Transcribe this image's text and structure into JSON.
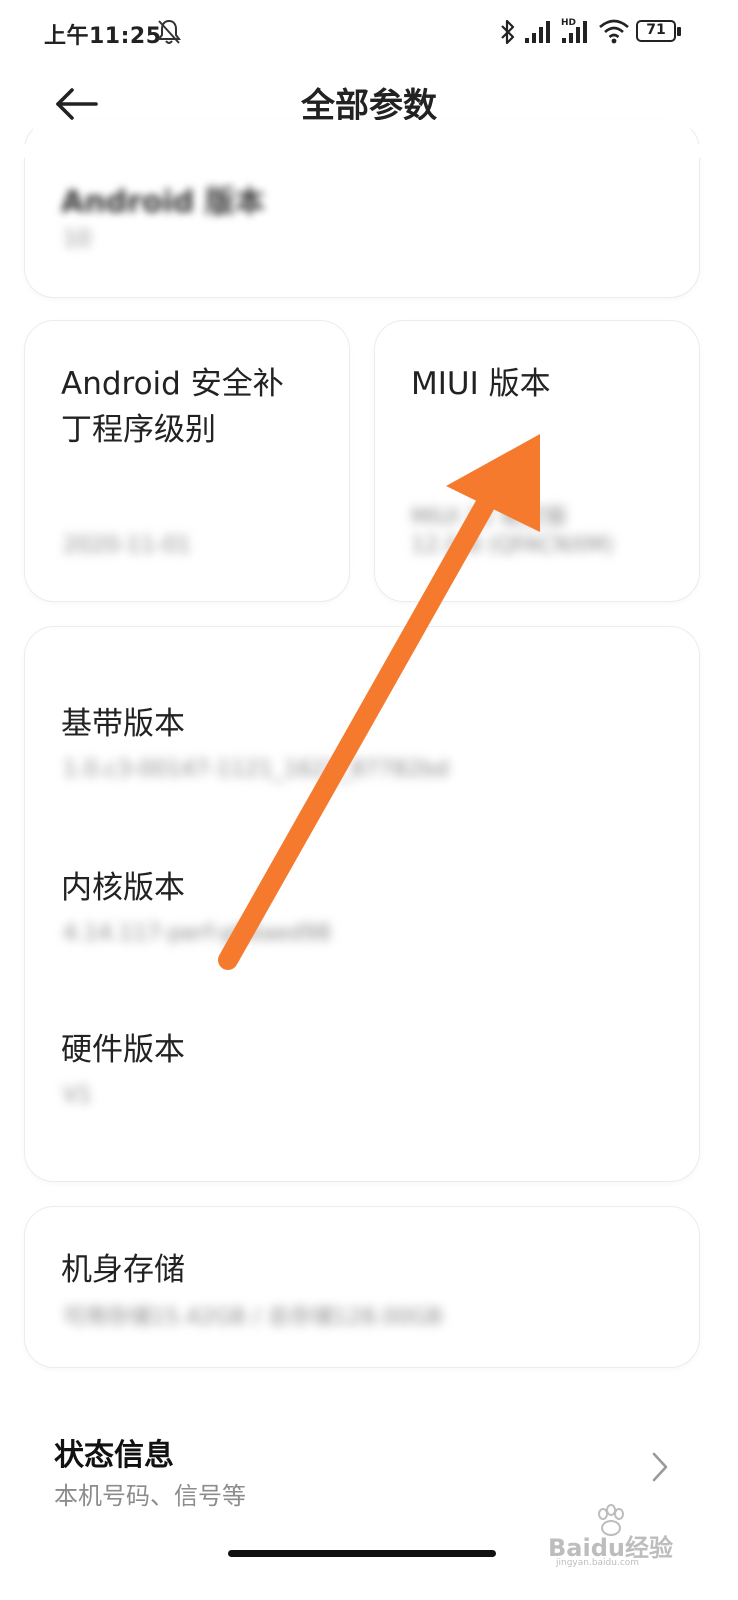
{
  "status_bar": {
    "time": "上午11:25",
    "battery": "71",
    "network_badge": "HD",
    "icons": [
      "mute-bell-icon",
      "bluetooth-icon",
      "signal-icon",
      "hd-signal-icon",
      "wifi-icon",
      "battery-icon"
    ]
  },
  "header": {
    "title": "全部参数",
    "back_icon": "back-arrow-icon"
  },
  "cards": {
    "android_version": {
      "label": "Android 版本",
      "value": "10"
    },
    "security_patch": {
      "label_line1": "Android 安全补",
      "label_line2": "丁程序级别",
      "value": "2020-11-01"
    },
    "miui_version": {
      "label": "MIUI 版本",
      "value_line1": "MIUI 12 稳定版",
      "value_line2": "12.0.8 (QFACNXM)"
    },
    "baseband": {
      "label": "基带版本",
      "value": "1.0.c3-00147-1121_1621_87782bd"
    },
    "kernel": {
      "label": "内核版本",
      "value": "4.14.117-perf-g66aed98"
    },
    "hardware": {
      "label": "硬件版本",
      "value": "V1"
    },
    "storage": {
      "label": "机身存储",
      "value": "可用存储15.42GB / 总存储128.00GB"
    }
  },
  "status_info": {
    "title": "状态信息",
    "subtitle": "本机号码、信号等",
    "chevron_icon": "chevron-right-icon"
  },
  "watermark": {
    "brand": "Baidu经验",
    "url": "jingyan.baidu.com"
  },
  "colors": {
    "arrow": "#f57a2e",
    "card_border": "#ececec",
    "muted_text": "#8c8c8c"
  }
}
